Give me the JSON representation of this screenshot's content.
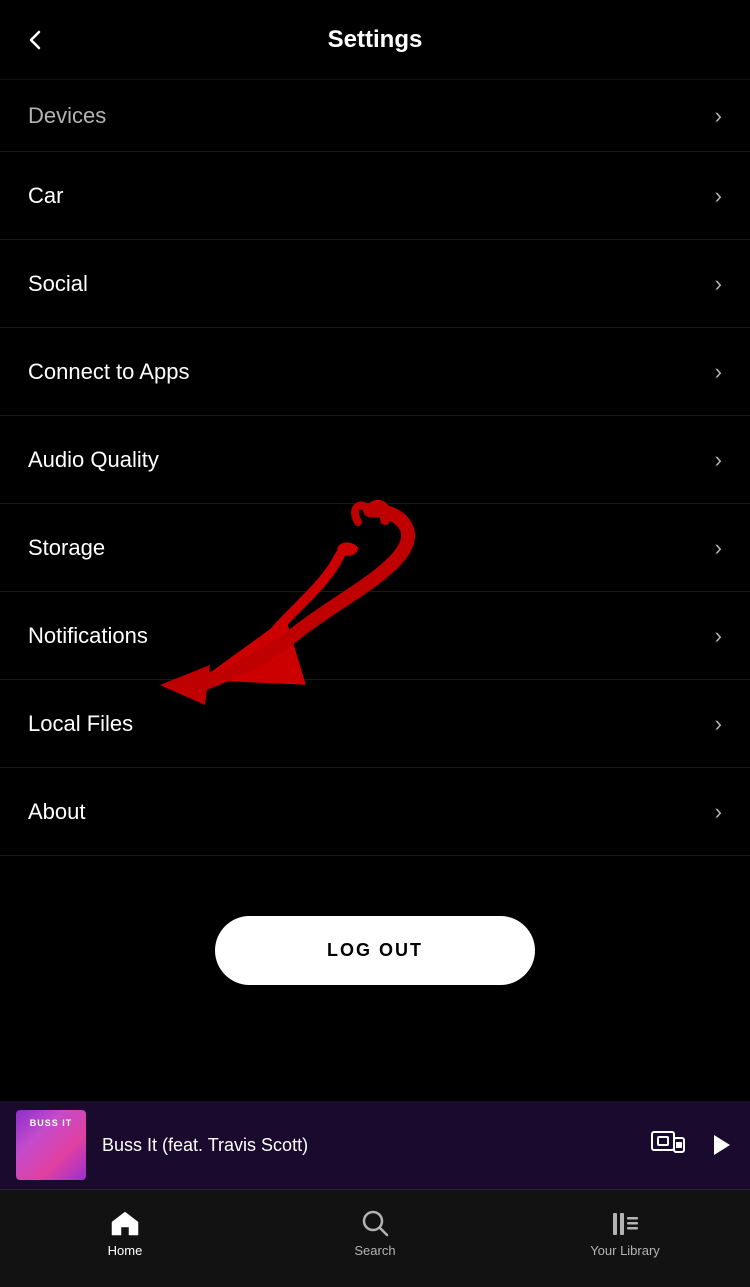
{
  "header": {
    "title": "Settings",
    "back_label": "‹"
  },
  "settings": {
    "items": [
      {
        "id": "devices",
        "label": "Devices",
        "faded": true
      },
      {
        "id": "car",
        "label": "Car",
        "faded": false
      },
      {
        "id": "social",
        "label": "Social",
        "faded": false
      },
      {
        "id": "connect-to-apps",
        "label": "Connect to Apps",
        "faded": false
      },
      {
        "id": "audio-quality",
        "label": "Audio Quality",
        "faded": false
      },
      {
        "id": "storage",
        "label": "Storage",
        "faded": false
      },
      {
        "id": "notifications",
        "label": "Notifications",
        "faded": false
      },
      {
        "id": "local-files",
        "label": "Local Files",
        "faded": false
      },
      {
        "id": "about",
        "label": "About",
        "faded": false
      }
    ],
    "logout_label": "LOG OUT"
  },
  "now_playing": {
    "title": "Buss It (feat. Travis Scott)",
    "album_art_text": "BUSS IT"
  },
  "bottom_nav": {
    "items": [
      {
        "id": "home",
        "label": "Home",
        "active": true,
        "icon": "home"
      },
      {
        "id": "search",
        "label": "Search",
        "active": false,
        "icon": "search"
      },
      {
        "id": "library",
        "label": "Your Library",
        "active": false,
        "icon": "library"
      }
    ]
  }
}
